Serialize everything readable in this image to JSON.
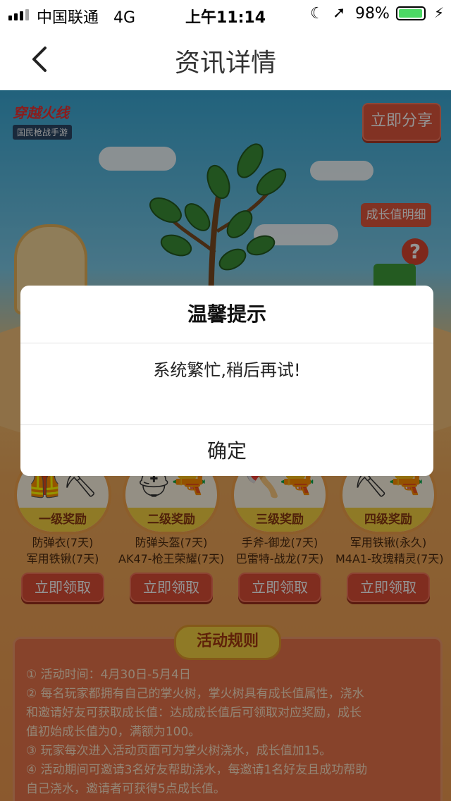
{
  "status_bar": {
    "carrier": "中国联通",
    "network": "4G",
    "time": "上午11:14",
    "battery": "98%",
    "battery_level": 0.98
  },
  "nav": {
    "title": "资讯详情"
  },
  "page": {
    "logo_title": "穿越火线",
    "logo_tagline": "国民枪战手游",
    "share_label": "立即分享",
    "growth_label": "成长值明细",
    "help_symbol": "?"
  },
  "rewards": [
    {
      "level": "一级奖励",
      "items": [
        "防弹衣(7天)",
        "军用铁锹(7天)"
      ],
      "claim": "立即领取",
      "icons": "🦺⛏"
    },
    {
      "level": "二级奖励",
      "items": [
        "防弹头盔(7天)",
        "AK47-枪王荣耀(7天)"
      ],
      "claim": "立即领取",
      "icons": "⛑🔫"
    },
    {
      "level": "三级奖励",
      "items": [
        "手斧-御龙(7天)",
        "巴雷特-战龙(7天)"
      ],
      "claim": "立即领取",
      "icons": "🪓🔫"
    },
    {
      "level": "四级奖励",
      "items": [
        "军用铁锹(永久)",
        "M4A1-玫瑰精灵(7天)"
      ],
      "claim": "立即领取",
      "icons": "⛏🔫"
    }
  ],
  "rules": {
    "title": "活动规则",
    "lines": [
      "① 活动时间：4月30日-5月4日",
      "② 每名玩家都拥有自己的掌火树，掌火树具有成长值属性，浇水",
      "和邀请好友可获取成长值：达成成长值后可领取对应奖励，成长",
      "值初始成长值为0，满额为100。",
      "③ 玩家每次进入活动页面可为掌火树浇水，成长值加15。",
      "④ 活动期间可邀请3名好友帮助浇水，每邀请1名好友且成功帮助",
      "自己浇水，邀请者可获得5点成长值。"
    ]
  },
  "dialog": {
    "title": "温馨提示",
    "message": "系统繁忙,稍后再试!",
    "confirm": "确定"
  }
}
